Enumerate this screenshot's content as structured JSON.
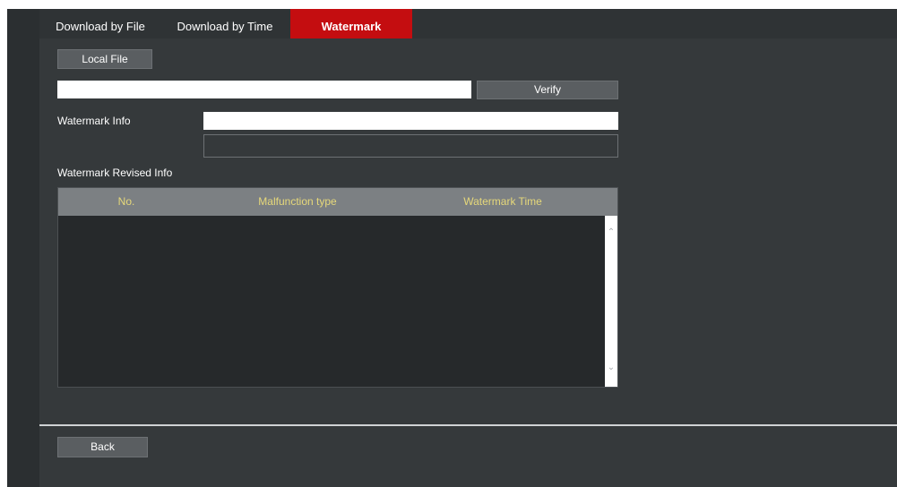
{
  "tabs": [
    {
      "label": "Download by File",
      "active": false
    },
    {
      "label": "Download by Time",
      "active": false
    },
    {
      "label": "Watermark",
      "active": true
    }
  ],
  "local_file_button": "Local File",
  "file_path_input": {
    "value": "",
    "placeholder": ""
  },
  "verify_button": "Verify",
  "watermark_info": {
    "label": "Watermark Info",
    "value": "",
    "detail_value": ""
  },
  "revised_info": {
    "label": "Watermark Revised Info",
    "columns": [
      "No.",
      "Malfunction type",
      "Watermark Time"
    ],
    "rows": []
  },
  "back_button": "Back",
  "colors": {
    "active_tab": "#c40d10",
    "background": "#35393b",
    "header_text": "#e6d87a"
  }
}
